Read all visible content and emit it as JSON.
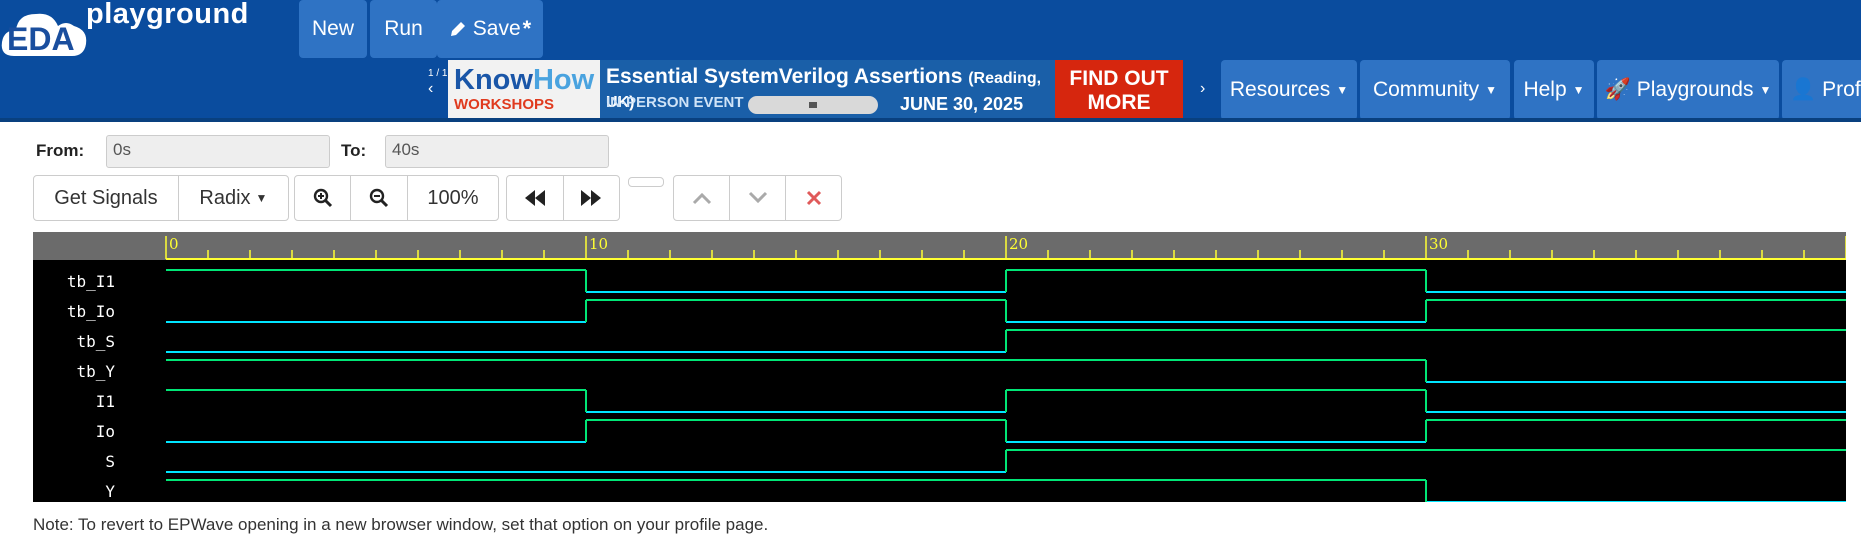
{
  "app": {
    "logo_primary": "EDA",
    "logo_secondary": "playground"
  },
  "toolbar": {
    "new_label": "New",
    "run_label": "Run",
    "save_label": "Save",
    "save_modified_marker": "*"
  },
  "banner": {
    "pager": "1 / 1",
    "prev_glyph": "‹",
    "next_glyph": "›",
    "brand_a": "Know",
    "brand_b": "How",
    "brand_sub": "WORKSHOPS",
    "headline": "Essential SystemVerilog Assertions",
    "location": "(Reading, UK)",
    "event": "IN-PERSON EVENT",
    "date": "JUNE 30, 2025",
    "cta": "FIND OUT MORE"
  },
  "nav": {
    "items": [
      "Resources",
      "Community",
      "Help",
      "Playgrounds",
      "Prof"
    ]
  },
  "range": {
    "from_label": "From:",
    "from_value": "0s",
    "to_label": "To:",
    "to_value": "40s"
  },
  "wave_toolbar": {
    "get_signals": "Get Signals",
    "radix": "Radix",
    "zoom_level": "100%"
  },
  "waveform": {
    "time_labels": [
      "0",
      "10",
      "20",
      "30"
    ],
    "time_range": [
      0,
      40
    ],
    "signals": [
      {
        "name": "tb_I1",
        "transitions": [
          [
            0,
            1
          ],
          [
            10,
            0
          ],
          [
            20,
            1
          ],
          [
            30,
            0
          ]
        ]
      },
      {
        "name": "tb_Io",
        "transitions": [
          [
            0,
            0
          ],
          [
            10,
            1
          ],
          [
            20,
            0
          ],
          [
            30,
            1
          ]
        ]
      },
      {
        "name": "tb_S",
        "transitions": [
          [
            0,
            0
          ],
          [
            20,
            1
          ]
        ]
      },
      {
        "name": "tb_Y",
        "transitions": [
          [
            0,
            1
          ],
          [
            10,
            1
          ],
          [
            20,
            1
          ],
          [
            30,
            0
          ]
        ]
      },
      {
        "name": "I1",
        "transitions": [
          [
            0,
            1
          ],
          [
            10,
            0
          ],
          [
            20,
            1
          ],
          [
            30,
            0
          ]
        ]
      },
      {
        "name": "Io",
        "transitions": [
          [
            0,
            0
          ],
          [
            10,
            1
          ],
          [
            20,
            0
          ],
          [
            30,
            1
          ]
        ]
      },
      {
        "name": "S",
        "transitions": [
          [
            0,
            0
          ],
          [
            20,
            1
          ]
        ]
      },
      {
        "name": "Y",
        "transitions": [
          [
            0,
            1
          ],
          [
            10,
            1
          ],
          [
            20,
            1
          ],
          [
            30,
            0
          ]
        ]
      }
    ],
    "colors": {
      "high": "#00e676",
      "low": "#00e5ff",
      "ruler": "#6b6b6b",
      "tick": "#ffff33"
    }
  },
  "note": "Note: To revert to EPWave opening in a new browser window, set that option on your profile page."
}
